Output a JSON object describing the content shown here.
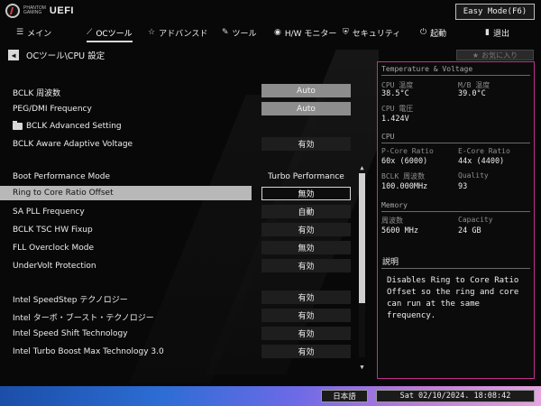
{
  "brand": {
    "line1": "PHANTOM",
    "line2": "GAMING",
    "uefi": "UEFI"
  },
  "easy_mode": "Easy Mode(F6)",
  "tabs": [
    {
      "icon": "☰",
      "label": "メイン"
    },
    {
      "icon": "⟋",
      "label": "OCツール"
    },
    {
      "icon": "☆",
      "label": "アドバンスド"
    },
    {
      "icon": "✎",
      "label": "ツール"
    },
    {
      "icon": "◉",
      "label": "H/W モニター"
    },
    {
      "icon": "⛨",
      "label": "セキュリティ"
    },
    {
      "icon": "⏻",
      "label": "起動"
    },
    {
      "icon": "▮",
      "label": "退出"
    }
  ],
  "breadcrumb": {
    "back_icon": "◀",
    "path": "OCツール\\CPU 設定"
  },
  "favorite": {
    "icon": "★",
    "label": "お気に入り"
  },
  "settings": [
    {
      "label": "BCLK 周波数",
      "value": "Auto",
      "style": "gray"
    },
    {
      "label": "PEG/DMI Frequency",
      "value": "Auto",
      "style": "gray"
    },
    {
      "label": "BCLK Advanced Setting",
      "value": "",
      "style": "folder"
    },
    {
      "label": "BCLK Aware Adaptive Voltage",
      "value": "有効",
      "style": "dark"
    },
    {
      "label": "Boot Performance Mode",
      "value": "Turbo Performance",
      "style": "plain"
    },
    {
      "label": "Ring to Core Ratio Offset",
      "value": "無効",
      "style": "selected"
    },
    {
      "label": "SA PLL Frequency",
      "value": "自動",
      "style": "dark"
    },
    {
      "label": "BCLK TSC HW Fixup",
      "value": "有効",
      "style": "dark"
    },
    {
      "label": "FLL Overclock Mode",
      "value": "無効",
      "style": "dark"
    },
    {
      "label": "UnderVolt Protection",
      "value": "有効",
      "style": "dark"
    },
    {
      "label": "Intel SpeedStep テクノロジー",
      "value": "有効",
      "style": "dark"
    },
    {
      "label": "Intel ターボ・ブースト・テクノロジー",
      "value": "有効",
      "style": "dark"
    },
    {
      "label": "Intel Speed Shift Technology",
      "value": "有効",
      "style": "dark"
    },
    {
      "label": "Intel Turbo Boost Max Technology 3.0",
      "value": "有効",
      "style": "dark"
    }
  ],
  "scroll": {
    "up": "▲",
    "down": "▼"
  },
  "panel": {
    "temp_title": "Temperature & Voltage",
    "cpu_temp_label": "CPU 温度",
    "cpu_temp": "38.5°C",
    "mb_temp_label": "M/B 温度",
    "mb_temp": "39.0°C",
    "cpu_volt_label": "CPU 電圧",
    "cpu_volt": "1.424V",
    "cpu_title": "CPU",
    "pcore_label": "P-Core Ratio",
    "pcore": "60x (6000)",
    "ecore_label": "E-Core Ratio",
    "ecore": "44x (4400)",
    "bclk_label": "BCLK 周波数",
    "bclk": "100.000MHz",
    "quality_label": "Quality",
    "quality": "93",
    "mem_title": "Memory",
    "freq_label": "周波数",
    "freq": "5600 MHz",
    "cap_label": "Capacity",
    "cap": "24 GB",
    "desc_title": "説明",
    "desc": "Disables Ring to Core Ratio Offset so the ring and core can run at the same frequency."
  },
  "footer": {
    "language": "日本語",
    "datetime": "Sat 02/10/2024. 18:08:42"
  }
}
